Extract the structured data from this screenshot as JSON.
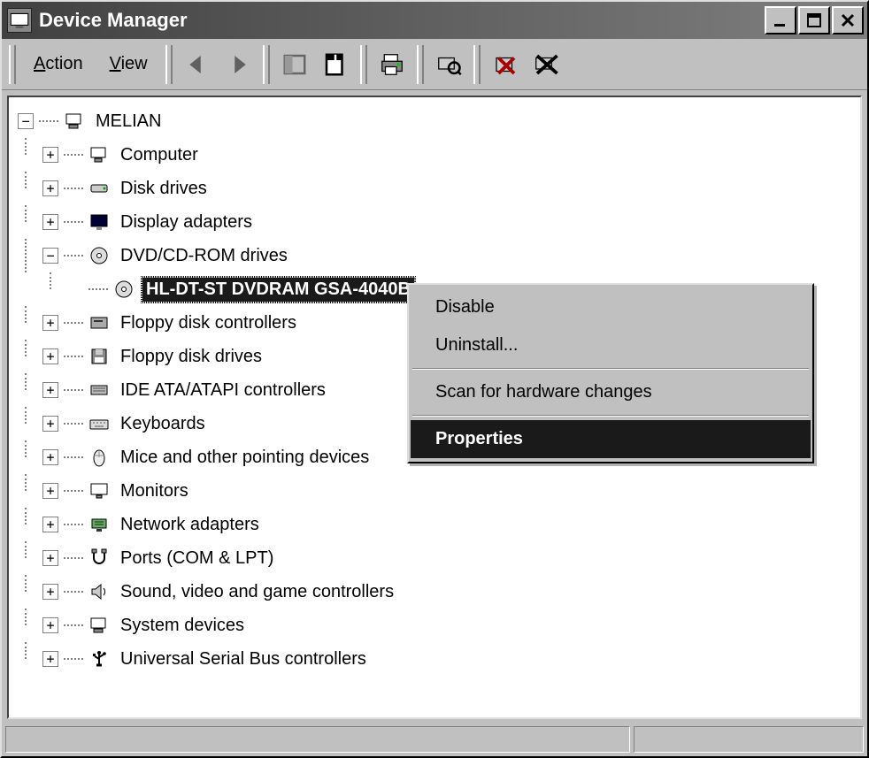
{
  "window": {
    "title": "Device Manager"
  },
  "menu": {
    "action": "Action",
    "view": "View"
  },
  "tree": {
    "root": "MELIAN",
    "items": [
      {
        "label": "Computer",
        "icon": "computer"
      },
      {
        "label": "Disk drives",
        "icon": "disk"
      },
      {
        "label": "Display adapters",
        "icon": "display"
      },
      {
        "label": "DVD/CD-ROM drives",
        "icon": "dvd",
        "expanded": true,
        "children": [
          {
            "label": "HL-DT-ST DVDRAM GSA-4040B",
            "icon": "dvd",
            "selected": true
          }
        ]
      },
      {
        "label": "Floppy disk controllers",
        "icon": "floppy-ctrl"
      },
      {
        "label": "Floppy disk drives",
        "icon": "floppy"
      },
      {
        "label": "IDE ATA/ATAPI controllers",
        "icon": "ide"
      },
      {
        "label": "Keyboards",
        "icon": "keyboard"
      },
      {
        "label": "Mice and other pointing devices",
        "icon": "mouse"
      },
      {
        "label": "Monitors",
        "icon": "monitor"
      },
      {
        "label": "Network adapters",
        "icon": "network"
      },
      {
        "label": "Ports (COM & LPT)",
        "icon": "port"
      },
      {
        "label": "Sound, video and game controllers",
        "icon": "sound"
      },
      {
        "label": "System devices",
        "icon": "system"
      },
      {
        "label": "Universal Serial Bus controllers",
        "icon": "usb"
      }
    ]
  },
  "context_menu": {
    "disable": "Disable",
    "uninstall": "Uninstall...",
    "scan": "Scan for hardware changes",
    "properties": "Properties"
  }
}
